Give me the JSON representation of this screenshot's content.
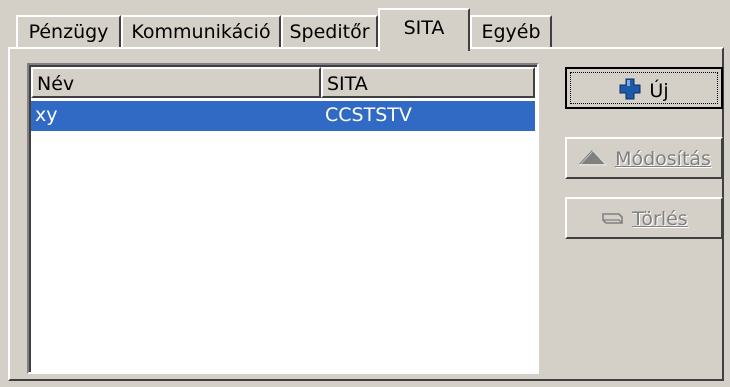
{
  "tabs": [
    {
      "label": "Pénzügy",
      "active": false
    },
    {
      "label": "Kommunikáció",
      "active": false
    },
    {
      "label": "Speditőr",
      "active": false
    },
    {
      "label": "SITA",
      "active": true
    },
    {
      "label": "Egyéb",
      "active": false
    }
  ],
  "list": {
    "columns": [
      "Név",
      "SITA"
    ],
    "rows": [
      {
        "nev": "xy",
        "sita": "CCSTSTV",
        "selected": true
      }
    ]
  },
  "buttons": {
    "new": {
      "label": "Új",
      "icon": "plus-icon",
      "enabled": true
    },
    "modify": {
      "label": "Módosítás",
      "icon": "triangle-up-icon",
      "enabled": false
    },
    "delete": {
      "label": "Törlés",
      "icon": "eraser-icon",
      "enabled": false
    }
  },
  "colors": {
    "face": "#d4d0c8",
    "selection": "#316ac5",
    "plus_icon": "#1e5aa8",
    "disabled_text": "#808080"
  }
}
